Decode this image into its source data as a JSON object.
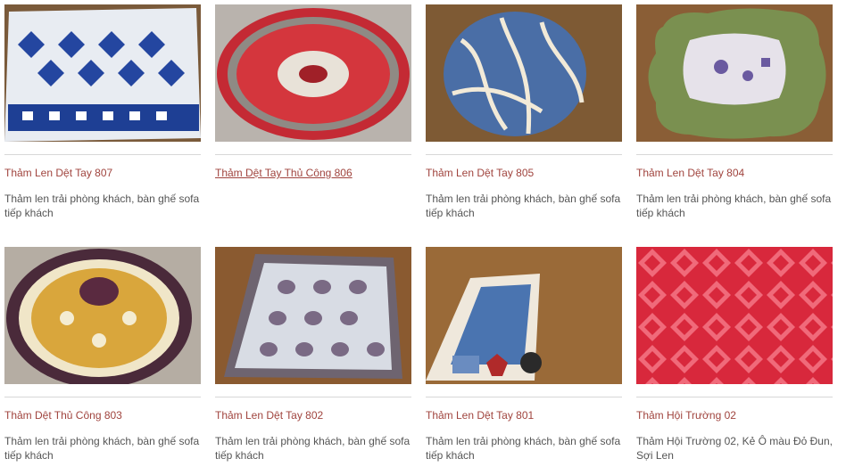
{
  "products": [
    {
      "title": "Thảm Len Dệt Tay 807",
      "desc": "Thảm len trải phòng khách, bàn ghế sofa tiếp khách"
    },
    {
      "title": "Thảm Dệt Tay Thủ Công 806",
      "desc": ""
    },
    {
      "title": "Thảm Len Dệt Tay 805",
      "desc": "Thảm len trải phòng khách, bàn ghế sofa tiếp khách"
    },
    {
      "title": "Thảm Len Dệt Tay 804",
      "desc": "Thảm len trải phòng khách, bàn ghế sofa tiếp khách"
    },
    {
      "title": "Thảm Dệt Thủ Công 803",
      "desc": "Thảm len trải phòng khách, bàn ghế sofa tiếp khách"
    },
    {
      "title": "Thảm Len Dệt Tay 802",
      "desc": "Thảm len trải phòng khách, bàn ghế sofa tiếp khách"
    },
    {
      "title": "Thảm Len Dệt Tay 801",
      "desc": "Thảm len trải phòng khách, bàn ghế sofa tiếp khách"
    },
    {
      "title": "Thảm Hội Trường 02",
      "desc": "Thảm Hội Trường 02, Kẻ Ô màu Đỏ Đun, Sợi Len"
    }
  ]
}
